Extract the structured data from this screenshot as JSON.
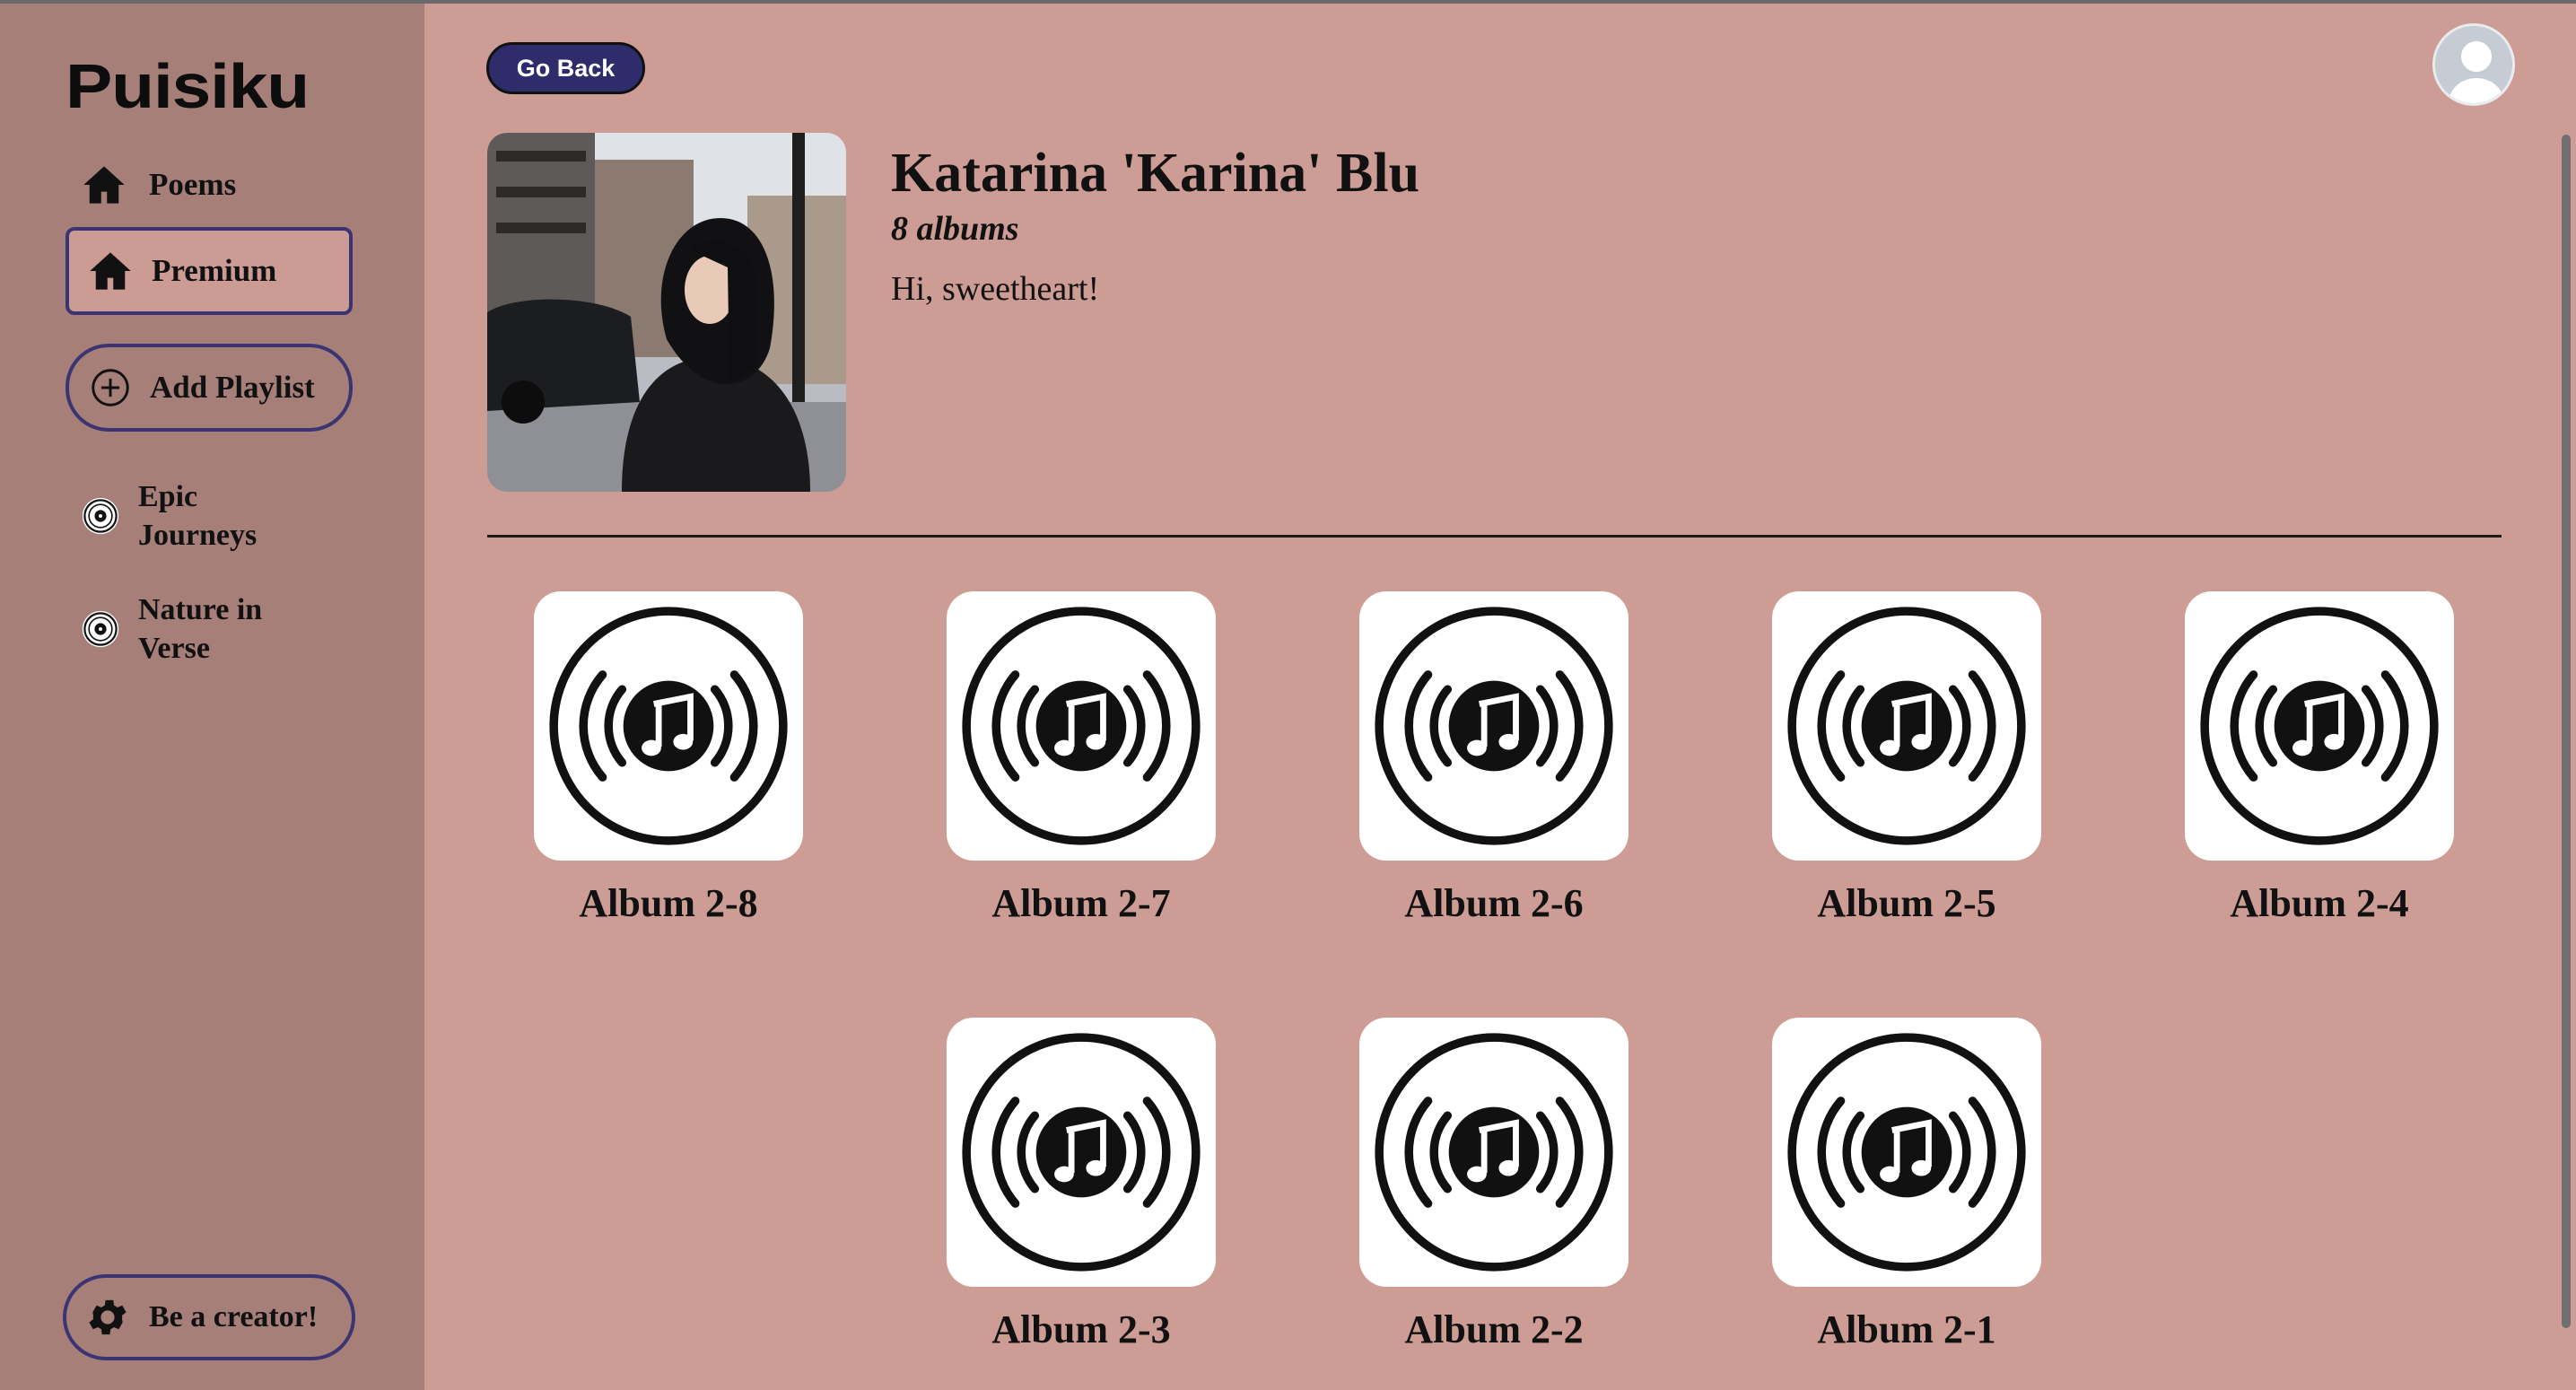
{
  "app": {
    "logo": "Puisiku"
  },
  "sidebar": {
    "nav": [
      {
        "label": "Poems",
        "icon": "home-icon"
      },
      {
        "label": "Premium",
        "icon": "home-icon"
      }
    ],
    "add_playlist_label": "Add Playlist",
    "playlists": [
      {
        "label_line1": "Epic",
        "label_line2": "Journeys",
        "icon": "vinyl-icon"
      },
      {
        "label_line1": "Nature in",
        "label_line2": "Verse",
        "icon": "vinyl-icon"
      }
    ],
    "creator_label": "Be a creator!"
  },
  "header": {
    "go_back_label": "Go Back",
    "avatar_icon": "user-avatar-icon"
  },
  "artist": {
    "name": "Katarina 'Karina' Blu",
    "album_count": "8 albums",
    "bio": "Hi, sweetheart!"
  },
  "albums": [
    {
      "title": "Album 2-8"
    },
    {
      "title": "Album 2-7"
    },
    {
      "title": "Album 2-6"
    },
    {
      "title": "Album 2-5"
    },
    {
      "title": "Album 2-4"
    },
    {
      "title": "Album 2-3"
    },
    {
      "title": "Album 2-2"
    },
    {
      "title": "Album 2-1"
    }
  ],
  "colors": {
    "page_bg": "#cd9d95",
    "sidebar_bg": "#a67f79",
    "accent": "#2e2c6b",
    "outline": "#3a3572"
  }
}
